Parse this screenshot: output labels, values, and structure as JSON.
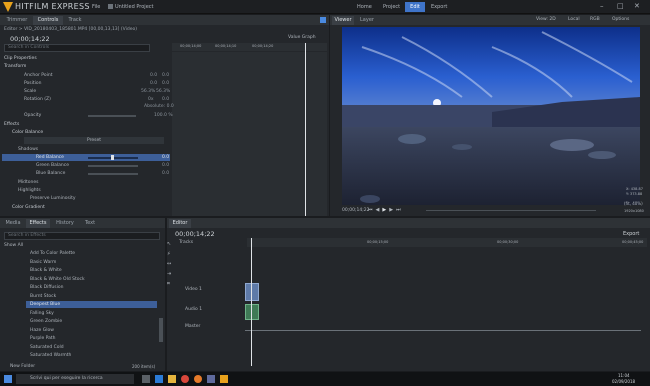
{
  "app": {
    "title": "HITFILM EXPRESS",
    "menu": [
      "File",
      "Untitled Project"
    ],
    "nav": [
      "Home",
      "Project",
      "Edit",
      "Export"
    ],
    "active_nav": "Edit",
    "win_ctrl": [
      "–",
      "□",
      "✕"
    ]
  },
  "left_tabs": [
    "Trimmer",
    "Controls",
    "Track"
  ],
  "editor_line": "Editor > VID_20180403_185801.MP4 [00,00,13,13] (Video)",
  "timecode_top": "00;00;14;22",
  "search_placeholder": "Search in Controls",
  "value_graph": "Value Graph",
  "ruler_top": [
    "00;00;14;00",
    "00;00;14;10",
    "00;00;14;20"
  ],
  "props": {
    "clip_properties": "Clip Properties",
    "transform": "Transform",
    "anchor": "Anchor Point",
    "position": "Position",
    "scale": "Scale",
    "rotation": "Rotation (Z)",
    "opacity": "Opacity",
    "anchor_vals": [
      "0.0",
      "0.0"
    ],
    "position_vals": [
      "0.0",
      "0.0"
    ],
    "scale_vals": [
      "56.3%",
      "56.3%"
    ],
    "rotation_vals": [
      "0x",
      "0.0"
    ],
    "absolute": "Absolute: 0.0",
    "opacity_val": "100.0 %",
    "effects": "Effects",
    "color_balance": "Color Balance",
    "preset": "Preset",
    "shadows": "Shadows",
    "red": "Red Balance",
    "green": "Green Balance",
    "blue": "Blue Balance",
    "red_val": "0.0",
    "green_val": "0.0",
    "blue_val": "0.0",
    "midtones": "Midtones",
    "highlights": "Highlights",
    "preserve": "Preserve Luminosity",
    "color_gradient": "Color Gradient"
  },
  "viewer": {
    "tabs": [
      "Viewer",
      "Layer"
    ],
    "view": "View: 2D",
    "mode": "Local",
    "color": "RGB",
    "options": "Options",
    "timecode": "00;00;14;22",
    "zoom": "(fit, 40%)",
    "coords": [
      "X: 438.87",
      "Y: 373.88"
    ],
    "size": "1920x1080"
  },
  "effects_panel": {
    "tabs": [
      "Media",
      "Effects",
      "History",
      "Text"
    ],
    "search_placeholder": "Search in Effects",
    "show": "Show All",
    "items": [
      "Add To Color Palette",
      "Basic Warm",
      "Black & White",
      "Black & White Old Stock",
      "Black Diffusion",
      "Burnt Stock",
      "Deepest Blue",
      "Falling Sky",
      "Green Zombie",
      "Haze Glow",
      "Purple Path",
      "Saturated Cold",
      "Saturated Warmth"
    ],
    "selected": "Deepest Blue",
    "new_folder": "New Folder",
    "count": "200 item(s)"
  },
  "editor": {
    "title": "Editor",
    "timecode": "00;00;14;22",
    "export": "Export",
    "tracks": "Tracks",
    "video_track": "Video 1",
    "audio_track": "Audio 1",
    "master": "Master",
    "ruler": [
      "00;00;15;00",
      "00;00;30;00",
      "00;00;45;00"
    ]
  },
  "taskbar": {
    "search": "Scrivi qui per eseguire la ricerca",
    "time": "11:04",
    "date": "02/09/2018"
  },
  "colors": {
    "accent": "#e8a21c",
    "selected": "#3d5f99",
    "nav_active": "#3f74c9"
  }
}
